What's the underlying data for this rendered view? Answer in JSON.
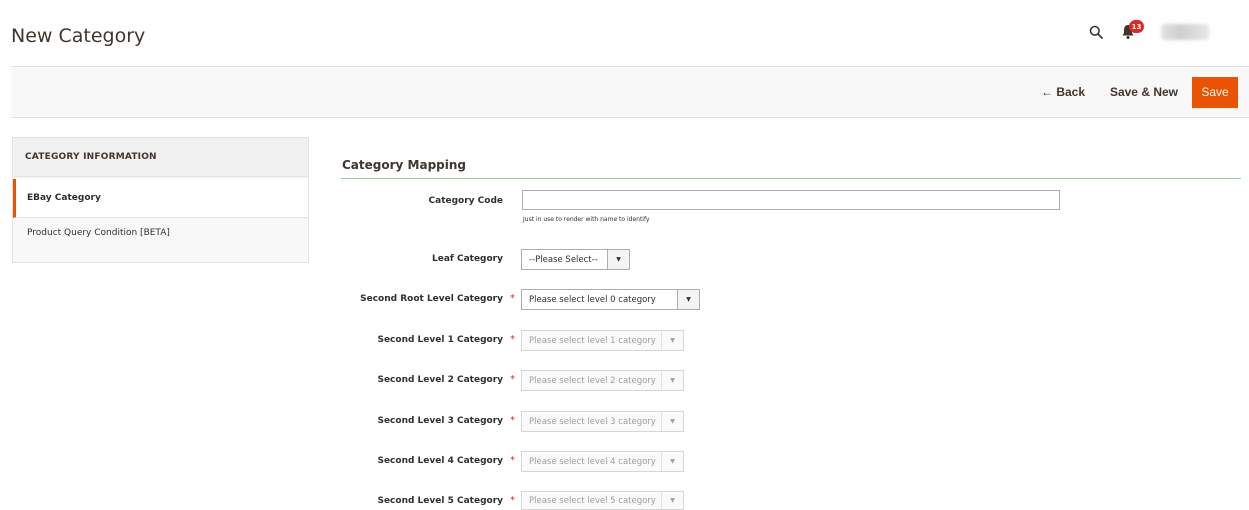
{
  "header": {
    "title": "New Category",
    "notification_count": "13"
  },
  "actions": {
    "back_label": "Back",
    "save_new_label": "Save & New",
    "save_label": "Save"
  },
  "tabs": {
    "title": "CATEGORY INFORMATION",
    "items": [
      {
        "label": "EBay Category"
      },
      {
        "label": "Product Query Condition [BETA]"
      }
    ]
  },
  "form": {
    "section_title": "Category Mapping",
    "category_code": {
      "label": "Category Code",
      "value": "",
      "note": "Just in use to render with name to identify"
    },
    "leaf_category": {
      "label": "Leaf Category",
      "value": "--Please Select--"
    },
    "levels": [
      {
        "label": "Second Root Level Category",
        "value": "Please select level 0 category"
      },
      {
        "label": "Second Level 1 Category",
        "value": "Please select level 1 category"
      },
      {
        "label": "Second Level 2 Category",
        "value": "Please select level 2 category"
      },
      {
        "label": "Second Level 3 Category",
        "value": "Please select level 3 category"
      },
      {
        "label": "Second Level 4 Category",
        "value": "Please select level 4 category"
      },
      {
        "label": "Second Level 5 Category",
        "value": "Please select level 5 category"
      }
    ],
    "required_mark": "*"
  },
  "colors": {
    "accent": "#eb5202",
    "badge": "#e22626",
    "section_rule": "#9ad0a2"
  }
}
